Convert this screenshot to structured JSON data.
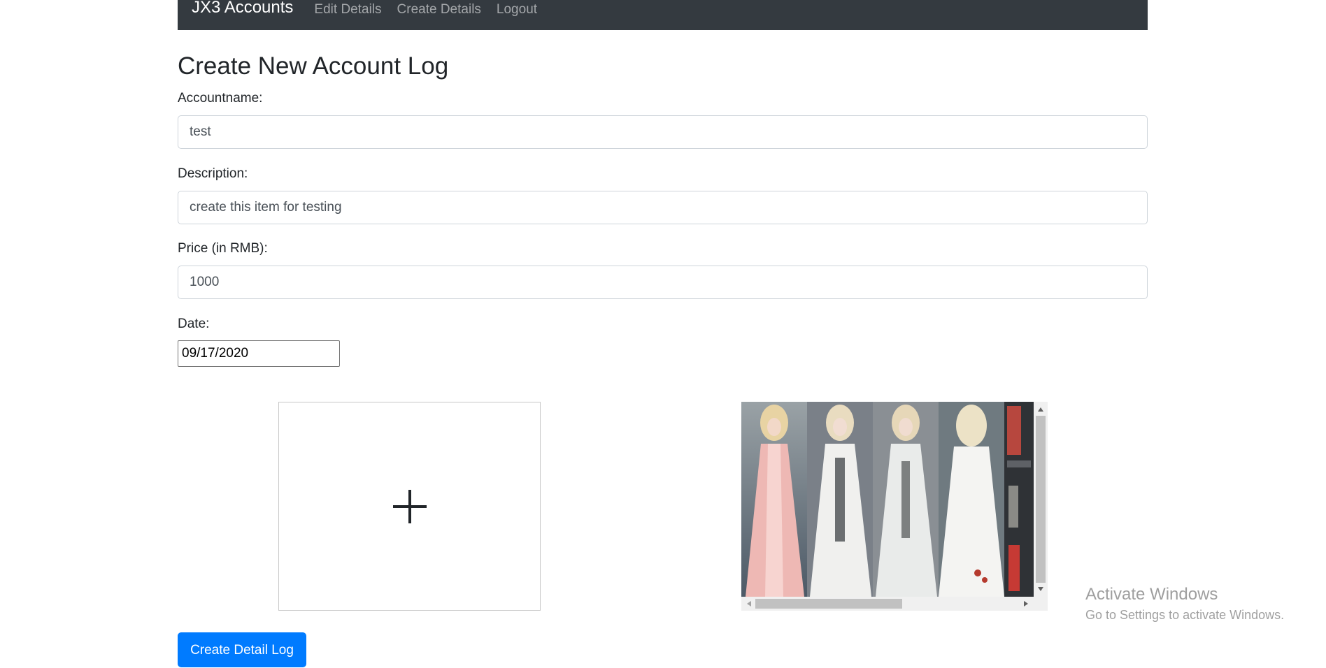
{
  "navbar": {
    "brand": "JX3 Accounts",
    "links": [
      "Edit Details",
      "Create Details",
      "Logout"
    ]
  },
  "page": {
    "title": "Create New Account Log"
  },
  "form": {
    "accountname": {
      "label": "Accountname:",
      "value": "test"
    },
    "description": {
      "label": "Description:",
      "value": "create this item for testing"
    },
    "price": {
      "label": "Price (in RMB):",
      "value": "1000"
    },
    "date": {
      "label": "Date:",
      "value": "09/17/2020"
    }
  },
  "upload": {
    "icon": "plus-icon"
  },
  "gallery": {
    "thumbnails": 5
  },
  "submit": {
    "label": "Create Detail Log"
  },
  "watermark": {
    "line1": "Activate Windows",
    "line2": "Go to Settings to activate Windows."
  },
  "colors": {
    "navbar": "#343a40",
    "primary": "#007bff"
  }
}
